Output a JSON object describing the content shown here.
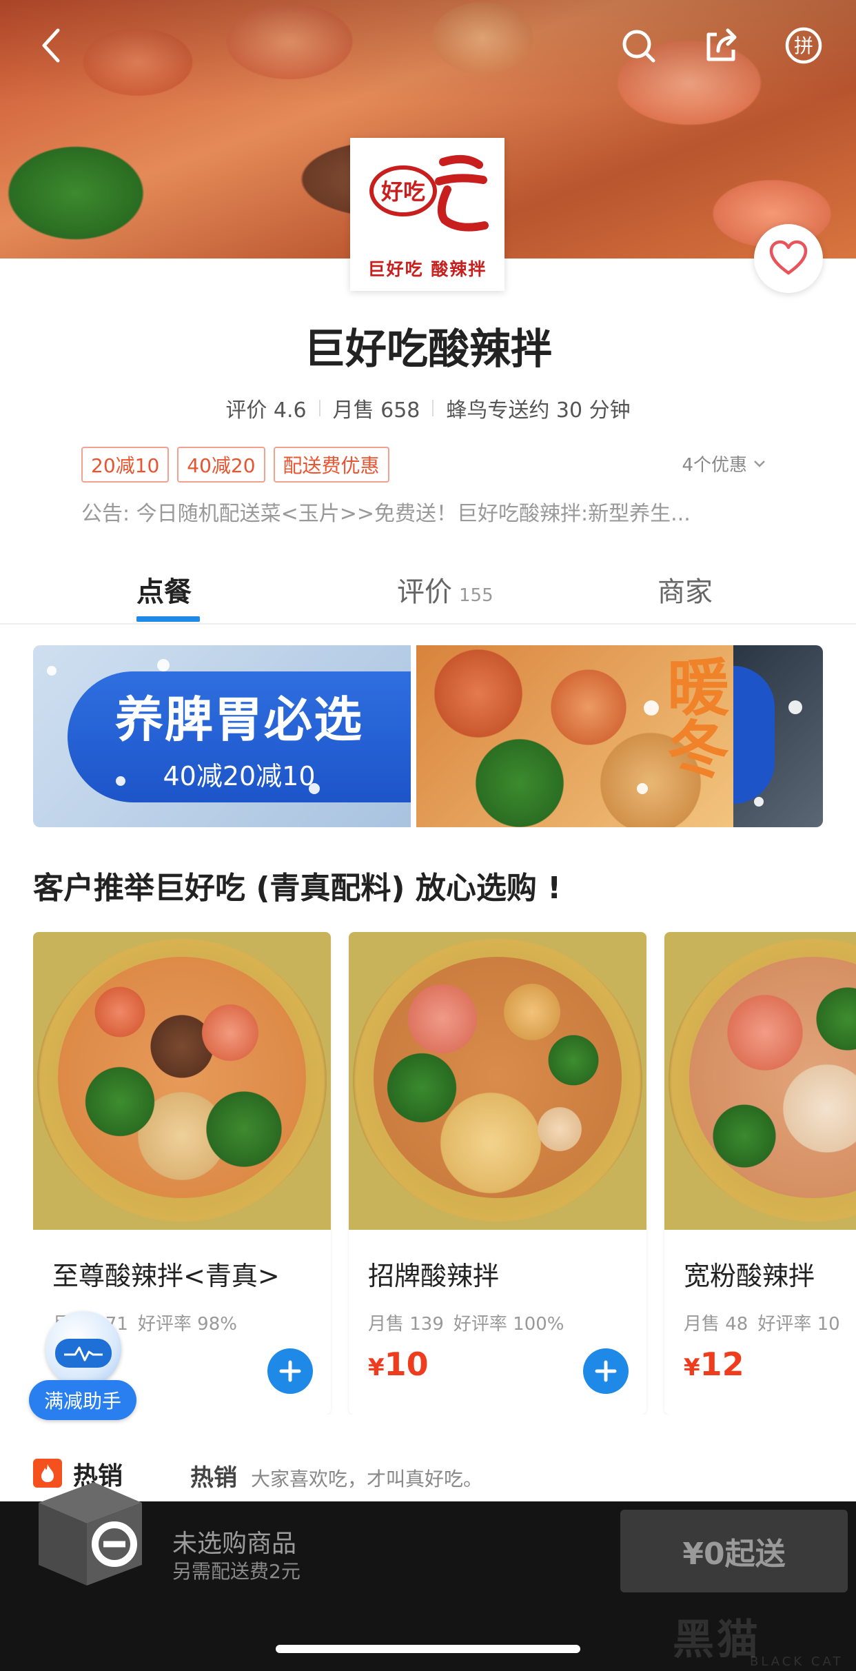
{
  "header": {
    "back_icon": "chevron-left-icon",
    "search_icon": "search-icon",
    "share_icon": "share-icon",
    "group_order_icon": "pin-icon",
    "group_order_glyph": "拼"
  },
  "shop": {
    "logo_text": "巨好吃 酸辣拌",
    "logo_mark_text": "好吃",
    "name": "巨好吃酸辣拌",
    "rating": "评价 4.6",
    "monthly_sales": "月售 658",
    "delivery": "蜂鸟专送约 30 分钟",
    "promos": [
      "20减10",
      "40减20",
      "配送费优惠"
    ],
    "promo_count": "4个优惠",
    "notice": "公告: 今日随机配送菜<玉片>>免费送！巨好吃酸辣拌:新型养生..."
  },
  "tabs": [
    {
      "label": "点餐",
      "count": ""
    },
    {
      "label": "评价",
      "count": "155"
    },
    {
      "label": "商家",
      "count": ""
    }
  ],
  "banner": {
    "title": "养脾胃必选",
    "subtitle": "40减20减10",
    "side_text": "暖冬"
  },
  "recommend": {
    "title": "客户推举巨好吃 (青真配料) 放心选购 !",
    "items": [
      {
        "name": "至尊酸辣拌<青真>",
        "sales": "月售 171",
        "rating": "好评率 98%",
        "currency": "¥",
        "price": "",
        "show_add": true
      },
      {
        "name": "招牌酸辣拌",
        "sales": "月售 139",
        "rating": "好评率 100%",
        "currency": "¥",
        "price": "10",
        "show_add": true
      },
      {
        "name": "宽粉酸辣拌",
        "sales": "月售 48",
        "rating": "好评率 10",
        "currency": "¥",
        "price": "12",
        "show_add": false
      }
    ]
  },
  "helper": {
    "label": "满减助手"
  },
  "hot": {
    "label": "热销",
    "heading": "热销",
    "description": "大家喜欢吃，才叫真好吃。"
  },
  "cart": {
    "title": "未选购商品",
    "subtitle": "另需配送费2元",
    "checkout": "¥0起送"
  },
  "watermark": {
    "text": "黑猫",
    "text_en": "BLACK CAT"
  },
  "colors": {
    "accent": "#1e89e6",
    "price": "#f03c1e",
    "promo": "#e8542f",
    "bottom_bar": "#141414"
  }
}
